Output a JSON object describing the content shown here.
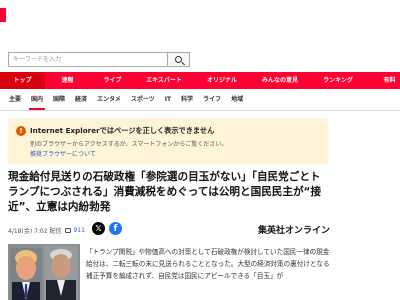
{
  "search": {
    "placeholder": "キーワードを入力"
  },
  "nav_main": [
    {
      "label": "トップ",
      "active": true
    },
    {
      "label": "速報",
      "active": false
    },
    {
      "label": "ライブ",
      "active": false
    },
    {
      "label": "エキスパート",
      "active": false
    },
    {
      "label": "オリジナル",
      "active": false
    },
    {
      "label": "みんなの意見",
      "active": false
    },
    {
      "label": "ランキング",
      "active": false
    },
    {
      "label": "有料",
      "active": false
    }
  ],
  "nav_sub": [
    {
      "label": "主要",
      "active": false
    },
    {
      "label": "国内",
      "active": true
    },
    {
      "label": "国際",
      "active": false
    },
    {
      "label": "経済",
      "active": false
    },
    {
      "label": "エンタメ",
      "active": false
    },
    {
      "label": "スポーツ",
      "active": false
    },
    {
      "label": "IT",
      "active": false
    },
    {
      "label": "科学",
      "active": false
    },
    {
      "label": "ライフ",
      "active": false
    },
    {
      "label": "地域",
      "active": false
    }
  ],
  "warning": {
    "icon": "!",
    "title": "Internet Explorerではページを正しく表示できません",
    "body": "別のブラウザーからアクセスするか、スマートフォンからご覧ください。",
    "link": "推奨ブラウザーについて"
  },
  "article": {
    "headline": "現金給付見送りの石破政権「参院選の目玉がない」「自民党ごとトランプにつぶされる」消費減税をめぐっては公明と国民民主が“接近”、立憲は内紛勃発",
    "date": "4/18(金) 7:02 配信",
    "comment_count": "911",
    "source": "集英社オンライン",
    "body": "「トランプ関税」や物価高への対策として石破政権が検討していた国民一律の現金給付は、二転三転の末に見送られることとなった。大型の経済対策の裏付けとなる補正予算を編成されず、自民党は国民にアピールできる「目玉」が"
  },
  "colors": {
    "brand_red": "#ff0033",
    "warning_bg": "#fff4d8",
    "link_blue": "#2563c9"
  }
}
